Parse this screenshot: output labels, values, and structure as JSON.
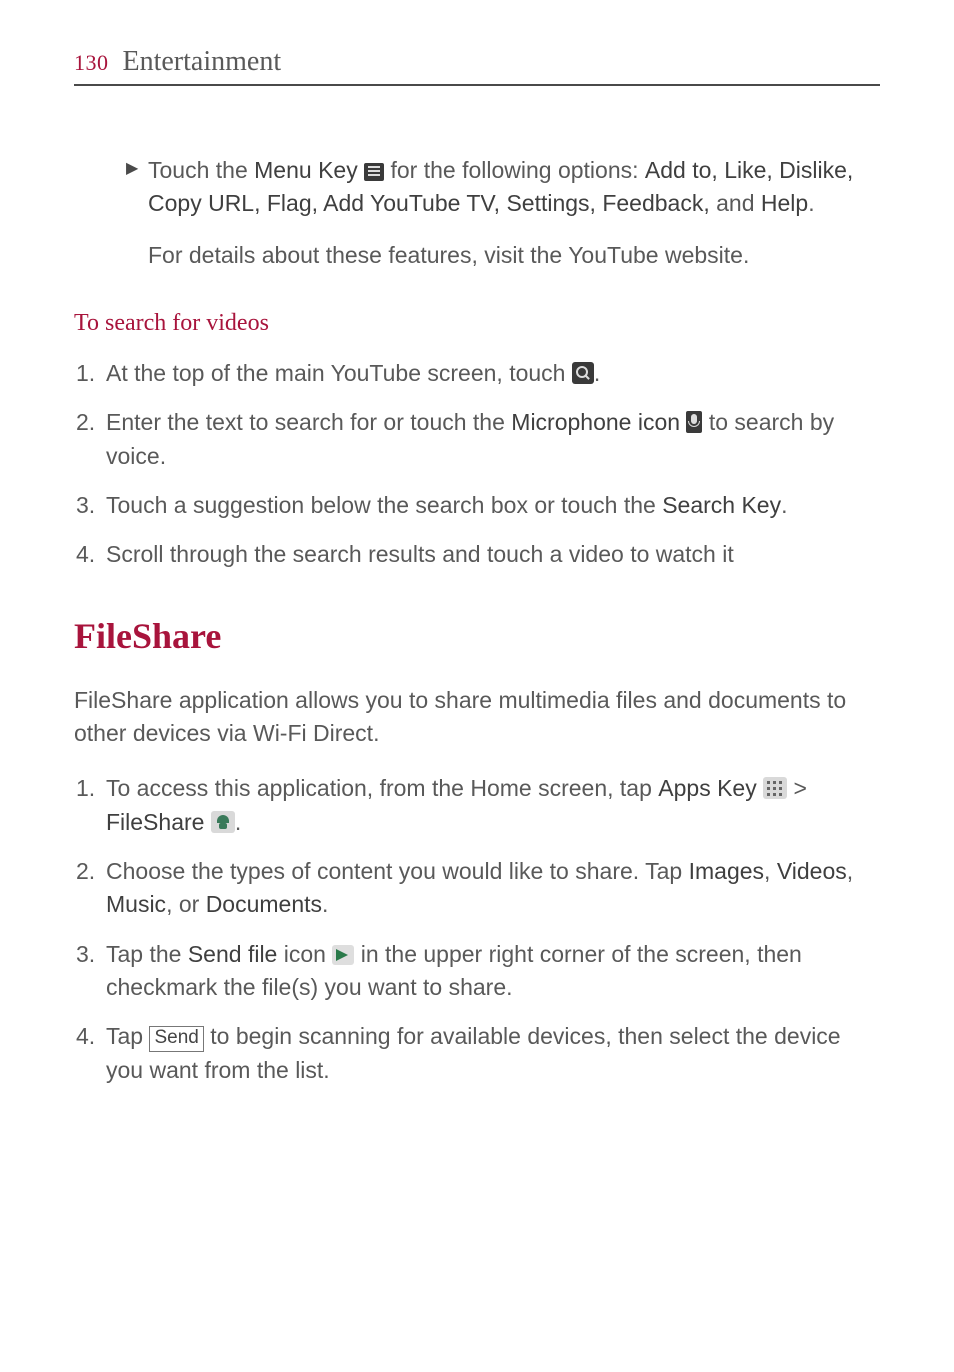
{
  "header": {
    "page_number": "130",
    "section": "Entertainment"
  },
  "menu_options": {
    "prefix": "Touch the ",
    "menu_key_label": "Menu Key",
    "mid": " for the following options: ",
    "options_bold": "Add to, Like, Dislike, Copy URL, Flag, Add YouTube TV, Settings, Feedback,",
    "and": " and ",
    "help": "Help",
    "period": "."
  },
  "details_note": "For details about these features, visit the YouTube website.",
  "search_section": {
    "heading": "To search for videos",
    "items": [
      {
        "num": "1.",
        "pre": "At the top of the main YouTube screen, touch ",
        "post": "."
      },
      {
        "num": "2.",
        "pre": "Enter the text to search for or touch the ",
        "bold": "Microphone icon",
        "mid": " ",
        "post": " to search by voice."
      },
      {
        "num": "3.",
        "pre": "Touch a suggestion below the search box or touch the ",
        "bold": "Search Key",
        "post": "."
      },
      {
        "num": "4.",
        "pre": "Scroll through the search results and touch a video to watch it"
      }
    ]
  },
  "fileshare": {
    "heading": "FileShare",
    "intro": "FileShare application allows you to share multimedia files and documents to other devices via Wi-Fi Direct.",
    "items": [
      {
        "num": "1.",
        "pre": "To access this application, from the Home screen, tap ",
        "apps_key": "Apps Key",
        "gt": " > ",
        "fileshare": "FileShare",
        "post": "."
      },
      {
        "num": "2.",
        "pre": "Choose the types of content you would like to share. Tap ",
        "b1": "Images",
        "c1": ", ",
        "b2": "Videos",
        "c2": ", ",
        "b3": "Music",
        "c3": ", or ",
        "b4": "Documents",
        "post": "."
      },
      {
        "num": "3.",
        "pre": "Tap the ",
        "bold": "Send file",
        "mid1": " icon ",
        "mid2": " in the upper right corner of the screen, then checkmark the file(s) you want to share."
      },
      {
        "num": "4.",
        "pre": "Tap ",
        "send": "Send",
        "post": " to begin scanning for available devices, then select the device you want from the list."
      }
    ]
  }
}
